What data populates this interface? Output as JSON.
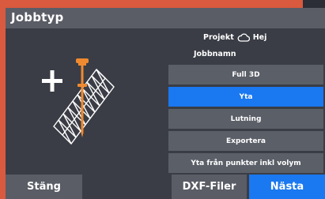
{
  "dialog": {
    "title": "Jobbtyp"
  },
  "info": {
    "project_label": "Projekt",
    "project_name": "Hej",
    "job_name_label": "Jobbnamn"
  },
  "options": [
    {
      "label": "Full 3D",
      "selected": false
    },
    {
      "label": "Yta",
      "selected": true
    },
    {
      "label": "Lutning",
      "selected": false
    },
    {
      "label": "Exportera",
      "selected": false
    },
    {
      "label": "Yta från punkter inkl volym",
      "selected": false
    }
  ],
  "buttons": {
    "close": "Stäng",
    "dxf": "DXF-Filer",
    "next": "Nästa"
  },
  "colors": {
    "accent": "#1a78f0",
    "dialog_bg": "#3a3d45",
    "button_bg": "#5a5d66",
    "background": "#d95a3f",
    "pole_orange": "#f08a30"
  },
  "icons": [
    "cloud-icon",
    "plus-icon",
    "survey-pole-icon",
    "surface-mesh-icon"
  ]
}
